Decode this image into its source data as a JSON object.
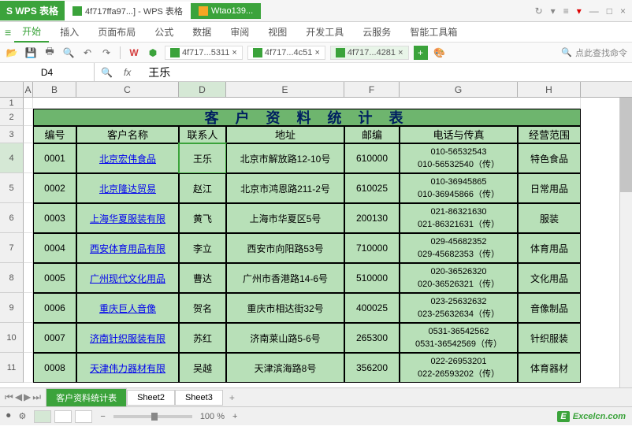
{
  "titlebar": {
    "app": "WPS 表格",
    "tab1": "4f717ffa97...] - WPS 表格",
    "tab2": "Wtao139..."
  },
  "menu": {
    "items": [
      "开始",
      "插入",
      "页面布局",
      "公式",
      "数据",
      "审阅",
      "视图",
      "开发工具",
      "云服务",
      "智能工具箱"
    ]
  },
  "toolbar": {
    "docs": [
      "4f717...5311 ×",
      "4f717...4c51 ×",
      "4f717...4281 ×"
    ],
    "find": "点此查找命令"
  },
  "formula": {
    "name_box": "D4",
    "value": "王乐"
  },
  "columns": [
    "A",
    "B",
    "C",
    "D",
    "E",
    "F",
    "G",
    "H"
  ],
  "row_nums": [
    "1",
    "2",
    "3",
    "4",
    "5",
    "6",
    "7",
    "8",
    "9",
    "10",
    "11"
  ],
  "table": {
    "title": "客 户 资 料 统 计 表",
    "headers": [
      "编号",
      "客户名称",
      "联系人",
      "地址",
      "邮编",
      "电话与传真",
      "经营范围"
    ],
    "rows": [
      {
        "id": "0001",
        "name": "北京宏伟食品",
        "contact": "王乐",
        "addr": "北京市解放路12-10号",
        "zip": "610000",
        "p1": "010-56532543",
        "p2": "010-56532540（传）",
        "biz": "特色食品"
      },
      {
        "id": "0002",
        "name": "北京隆达贸易",
        "contact": "赵江",
        "addr": "北京市鸿恩路211-2号",
        "zip": "610025",
        "p1": "010-36945865",
        "p2": "010-36945866（传）",
        "biz": "日常用品"
      },
      {
        "id": "0003",
        "name": "上海华夏服装有限",
        "contact": "黄飞",
        "addr": "上海市华夏区5号",
        "zip": "200130",
        "p1": "021-86321630",
        "p2": "021-86321631（传）",
        "biz": "服装"
      },
      {
        "id": "0004",
        "name": "西安体育用品有限",
        "contact": "李立",
        "addr": "西安市向阳路53号",
        "zip": "710000",
        "p1": "029-45682352",
        "p2": "029-45682353（传）",
        "biz": "体育用品"
      },
      {
        "id": "0005",
        "name": "广州现代文化用品",
        "contact": "曹达",
        "addr": "广州市香港路14-6号",
        "zip": "510000",
        "p1": "020-36526320",
        "p2": "020-36526321（传）",
        "biz": "文化用品"
      },
      {
        "id": "0006",
        "name": "重庆巨人音像",
        "contact": "贺名",
        "addr": "重庆市相达街32号",
        "zip": "400025",
        "p1": "023-25632632",
        "p2": "023-25632634（传）",
        "biz": "音像制品"
      },
      {
        "id": "0007",
        "name": "济南针织服装有限",
        "contact": "苏红",
        "addr": "济南莱山路5-6号",
        "zip": "265300",
        "p1": "0531-36542562",
        "p2": "0531-36542569（传）",
        "biz": "针织服装"
      },
      {
        "id": "0008",
        "name": "天津伟力器材有限",
        "contact": "吴越",
        "addr": "天津滨海路8号",
        "zip": "356200",
        "p1": "022-26953201",
        "p2": "022-26593202（传）",
        "biz": "体育器材"
      }
    ]
  },
  "sheets": [
    "客户资料统计表",
    "Sheet2",
    "Sheet3"
  ],
  "status": {
    "zoom": "100 %",
    "brand": "Excelcn.com"
  }
}
